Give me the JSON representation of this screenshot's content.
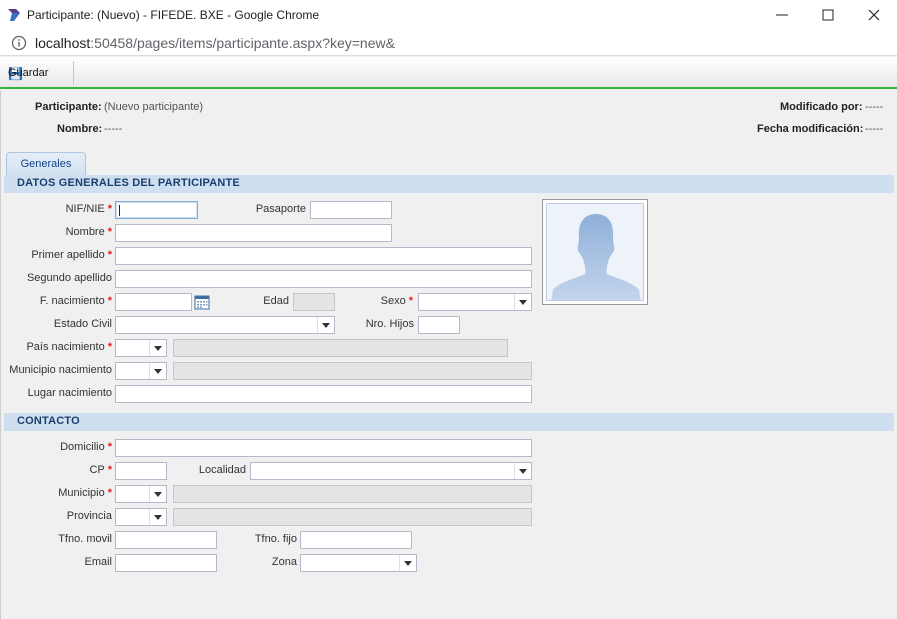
{
  "window": {
    "title": "Participante: (Nuevo) - FIFEDE. BXE - Google Chrome"
  },
  "address_bar": {
    "host": "localhost",
    "path": ":50458/pages/items/participante.aspx?key=new&"
  },
  "toolbar": {
    "save_label": "Guardar"
  },
  "header": {
    "participante_label": "Participante:",
    "participante_value": "(Nuevo participante)",
    "nombre_label": "Nombre:",
    "nombre_value": "-----",
    "modificado_label": "Modificado por:",
    "modificado_value": "-----",
    "fecha_label": "Fecha modificación:",
    "fecha_value": "-----"
  },
  "tabs": [
    {
      "label": "Generales"
    }
  ],
  "sections": {
    "general": "DATOS GENERALES DEL PARTICIPANTE",
    "contact": "CONTACTO"
  },
  "required_mark": "*",
  "general_fields": {
    "nif": "NIF/NIE",
    "pasaporte": "Pasaporte",
    "nombre": "Nombre",
    "primer_apellido": "Primer apellido",
    "segundo_apellido": "Segundo apellido",
    "f_nacimiento": "F. nacimiento",
    "edad": "Edad",
    "sexo": "Sexo",
    "estado_civil": "Estado Civil",
    "nro_hijos": "Nro. Hijos",
    "pais_nacimiento": "País nacimiento",
    "municipio_nacimiento": "Municipio nacimiento",
    "lugar_nacimiento": "Lugar nacimiento"
  },
  "contact_fields": {
    "domicilio": "Domicilio",
    "cp": "CP",
    "localidad": "Localidad",
    "municipio": "Municipio",
    "provincia": "Provincia",
    "tfno_movil": "Tfno. movil",
    "tfno_fijo": "Tfno. fijo",
    "email": "Email",
    "zona": "Zona"
  },
  "icons": {
    "app": "app-logo-icon",
    "info": "info-icon",
    "save": "floppy-disk-icon",
    "calendar": "calendar-icon",
    "photo": "person-silhouette-icon"
  },
  "colors": {
    "accent_green": "#35b335",
    "section_bg": "#cfdfef",
    "required": "#e02020"
  }
}
